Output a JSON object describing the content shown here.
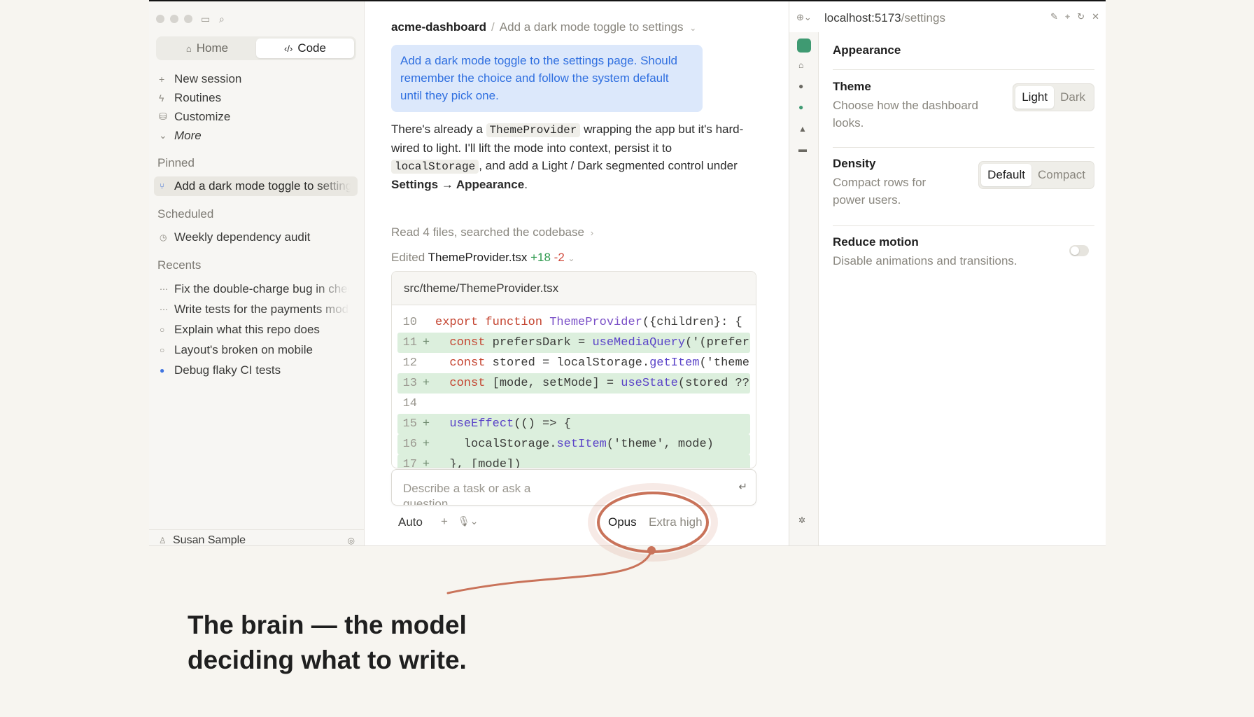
{
  "sidebar": {
    "modes": [
      {
        "label": "Home",
        "icon": "home-icon",
        "active": false
      },
      {
        "label": "Code",
        "icon": "code-icon",
        "active": true
      }
    ],
    "nav": [
      {
        "label": "New session",
        "icon": "plus-icon"
      },
      {
        "label": "Routines",
        "icon": "routines-icon"
      },
      {
        "label": "Customize",
        "icon": "customize-icon"
      },
      {
        "label": "More",
        "icon": "chevron-down-icon"
      }
    ],
    "pinned_heading": "Pinned",
    "pinned": [
      {
        "label": "Add a dark mode toggle to settings",
        "icon": "branch-icon"
      }
    ],
    "scheduled_heading": "Scheduled",
    "scheduled": [
      {
        "label": "Weekly dependency audit",
        "icon": "clock-icon"
      }
    ],
    "recents_heading": "Recents",
    "recents": [
      {
        "label": "Fix the double-charge bug in checkout",
        "icon": "ellipsis-icon"
      },
      {
        "label": "Write tests for the payments module",
        "icon": "ellipsis-icon"
      },
      {
        "label": "Explain what this repo does",
        "icon": "circle-icon"
      },
      {
        "label": "Layout's broken on mobile",
        "icon": "circle-icon"
      },
      {
        "label": "Debug flaky CI tests",
        "icon": "blue-dot-icon"
      }
    ],
    "user_name": "Susan Sample"
  },
  "chat": {
    "project": "acme-dashboard",
    "session_title": "Add a dark mode toggle to settings",
    "user_message": "Add a dark mode toggle to the settings page. Should remember the choice and follow the system default until they pick one.",
    "reply": {
      "p1": "There's already a ",
      "code1": "ThemeProvider",
      "p2": " wrapping the app but it's hard-wired to light. I'll lift the mode into context, persist it to ",
      "code2": "localStorage",
      "p3": ", and add a Light / Dark segmented control under ",
      "bold": "Settings → Appearance",
      "p4": "."
    },
    "activity": "Read 4 files, searched the codebase",
    "edited_prefix": "Edited",
    "edited_file": "ThemeProvider.tsx",
    "additions": "+18",
    "deletions": "-2",
    "code_path": "src/theme/ThemeProvider.tsx",
    "composer_placeholder": "Describe a task or ask a question",
    "permission_mode": "Auto",
    "model": "Opus",
    "effort": "Extra high"
  },
  "preview": {
    "url_host": "localhost:5173",
    "url_path": "/settings",
    "section": "Appearance",
    "theme": {
      "title": "Theme",
      "desc": "Choose how the dashboard looks.",
      "options": [
        "Light",
        "Dark"
      ],
      "selected": "Light"
    },
    "density": {
      "title": "Density",
      "desc": "Compact rows for power users.",
      "options": [
        "Default",
        "Compact"
      ],
      "selected": "Default"
    },
    "motion": {
      "title": "Reduce motion",
      "desc": "Disable animations and transitions.",
      "enabled": false
    }
  },
  "annotation": {
    "caption_line1": "The brain — the model",
    "caption_line2": "deciding what to write.",
    "color": "#c9735a"
  }
}
